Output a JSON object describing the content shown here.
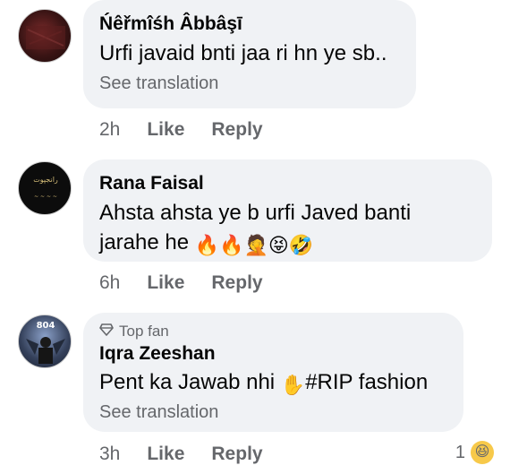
{
  "comments": [
    {
      "author": "Ńêřmîśh Âbbâşī",
      "text": "Urfi javaid bnti jaa ri hn ye sb..",
      "see_translation": "See translation",
      "time": "2h",
      "like": "Like",
      "reply": "Reply"
    },
    {
      "author": "Rana Faisal",
      "text_line1": "Ahsta ahsta ye b urfi Javed banti",
      "text_line2": "jarahe he",
      "emojis": "🔥🔥🤦😝🤣",
      "time": "6h",
      "like": "Like",
      "reply": "Reply",
      "avatar_text": "رانجپوت"
    },
    {
      "badge": "Top fan",
      "author": "Iqra Zeeshan",
      "text_before": "Pent ka Jawab nhi ",
      "emoji": "✋",
      "text_after": "#RIP fashion",
      "see_translation": "See translation",
      "time": "3h",
      "like": "Like",
      "reply": "Reply",
      "reaction_count": "1",
      "reaction_emoji": "😆",
      "avatar_text": "804"
    }
  ],
  "colors": {
    "bubble": "#f0f2f5",
    "secondary_text": "#65676b",
    "primary_text": "#050505"
  }
}
